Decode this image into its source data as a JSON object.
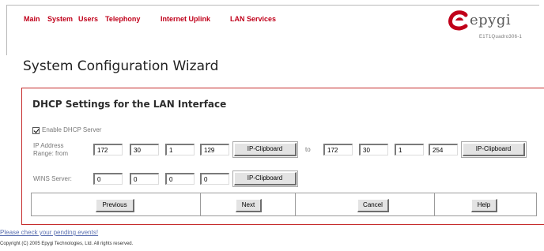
{
  "nav": {
    "main": "Main",
    "system": "System",
    "users": "Users",
    "telephony": "Telephony",
    "internet_uplink": "Internet Uplink",
    "lan_services": "LAN Services"
  },
  "brand": {
    "name": "epygi",
    "model": "E1T1Quadro306-1",
    "accent": "#c0001a"
  },
  "page_title": "System Configuration Wizard",
  "section_title": "DHCP Settings for the LAN Interface",
  "enable_dhcp": {
    "label": "Enable DHCP Server",
    "checked": true
  },
  "ip_range": {
    "label_line1": "IP Address",
    "label_line2": "Range: from",
    "from": [
      "172",
      "30",
      "1",
      "129"
    ],
    "to_label": "to",
    "to": [
      "172",
      "30",
      "1",
      "254"
    ],
    "clipboard_label": "IP-Clipboard"
  },
  "wins": {
    "label": "WINS Server:",
    "values": [
      "0",
      "0",
      "0",
      "0"
    ],
    "clipboard_label": "IP-Clipboard"
  },
  "buttons": {
    "previous": "Previous",
    "next": "Next",
    "cancel": "Cancel",
    "help": "Help"
  },
  "pending_link": "Please check your pending events!",
  "copyright": "Copyright (C) 2005 Epygi Technologies, Ltd. All rights reserved."
}
